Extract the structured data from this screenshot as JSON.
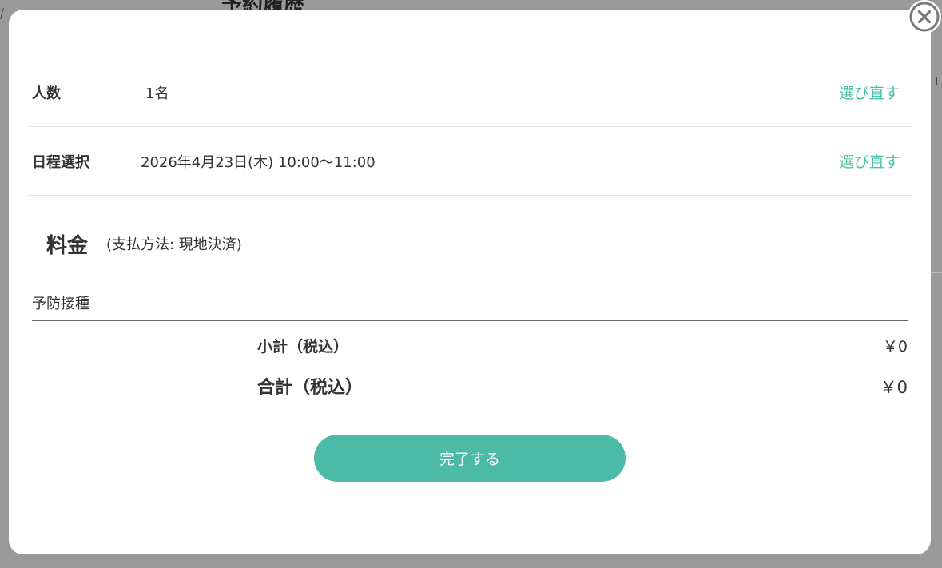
{
  "background": {
    "title": "予約履歴"
  },
  "modal": {
    "people": {
      "label": "人数",
      "value": "1名",
      "reselect_label": "選び直す"
    },
    "schedule": {
      "label": "日程選択",
      "value": "2026年4月23日(木) 10:00〜11:00",
      "reselect_label": "選び直す"
    },
    "fee": {
      "title": "料金",
      "payment_method": "(支払方法: 現地決済)",
      "item_name": "予防接種",
      "subtotal_label": "小計（税込）",
      "subtotal_value": "￥0",
      "total_label": "合計（税込）",
      "total_value": "￥0"
    },
    "complete_button_label": "完了する"
  },
  "colors": {
    "accent": "#4bbaa6",
    "link": "#4bbfa6",
    "overlay": "#9a9a9a"
  },
  "icons": {
    "close": "close-circle-icon"
  }
}
